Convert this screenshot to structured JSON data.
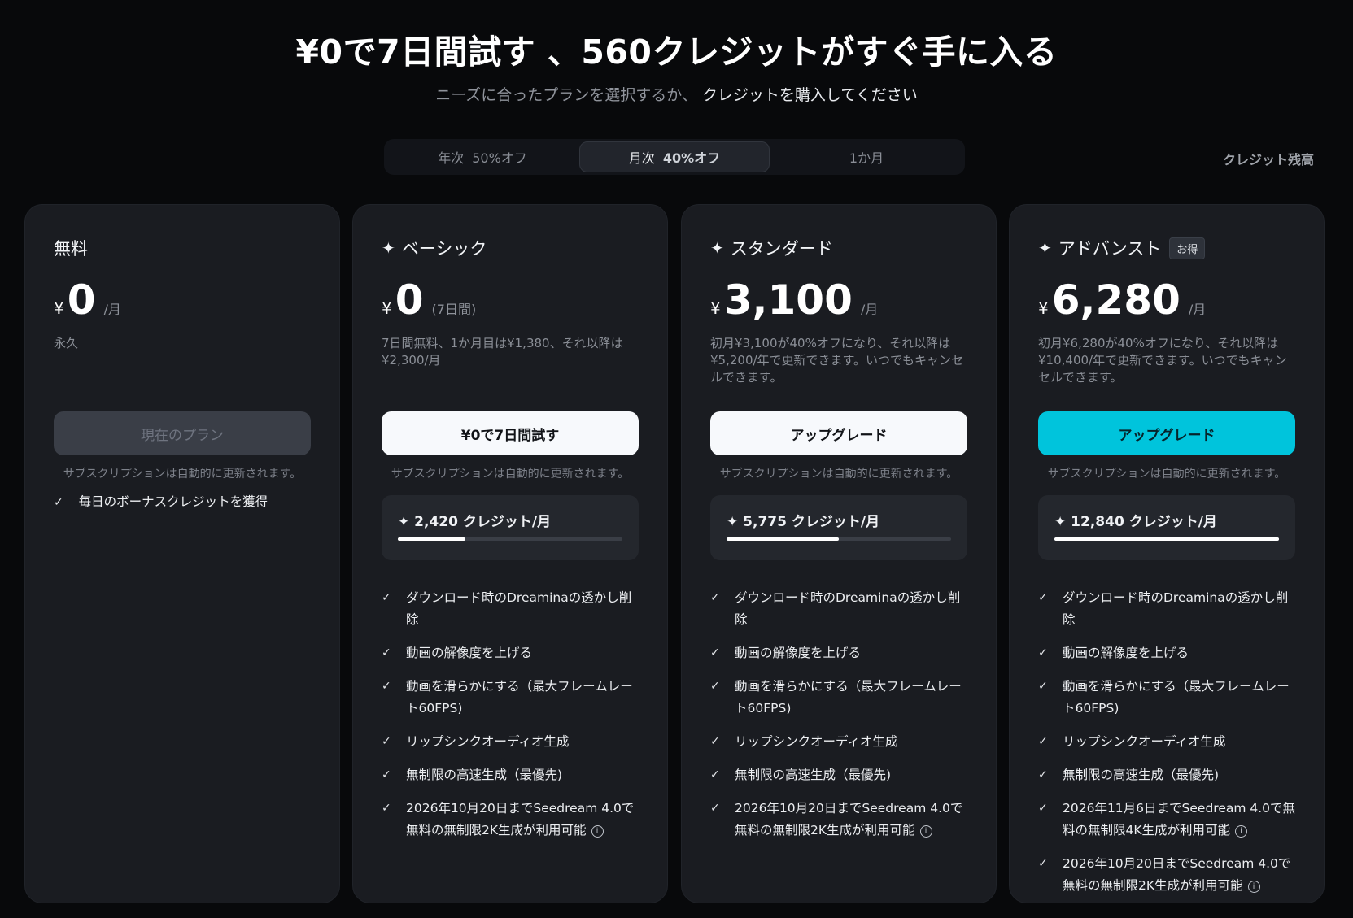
{
  "hero": {
    "title": "¥0で7日間試す 、560クレジットがすぐ手に入る",
    "subtitle_gray": "ニーズに合ったプランを選択するか、",
    "subtitle_link": "クレジットを購入してください"
  },
  "tabs": [
    {
      "label": "年次",
      "discount": "50%オフ"
    },
    {
      "label": "月次",
      "discount": "40%オフ"
    },
    {
      "label": "1か月",
      "discount": ""
    }
  ],
  "credit_balance_label": "クレジット残高",
  "plans": [
    {
      "name": "無料",
      "currency": "¥",
      "amount": "0",
      "period": "/月",
      "description": "永久",
      "cta": "現在のプラン",
      "renew_note": "サブスクリプションは自動的に更新されます。",
      "features": [
        "毎日のボーナスクレジットを獲得"
      ]
    },
    {
      "name": "ベーシック",
      "currency": "¥",
      "amount": "0",
      "period": "(7日間)",
      "description": "7日間無料、1か月目は¥1,380、それ以降は¥2,300/月",
      "cta": "¥0で7日間試す",
      "renew_note": "サブスクリプションは自動的に更新されます。",
      "credits": "2,420 クレジット/月",
      "credit_level": 0.3,
      "features": [
        "ダウンロード時のDreaminaの透かし削除",
        "動画の解像度を上げる",
        "動画を滑らかにする（最大フレームレート60FPS)",
        "リップシンクオーディオ生成",
        "無制限の高速生成（最優先)",
        "2026年10月20日までSeedream 4.0で無料の無制限2K生成が利用可能"
      ]
    },
    {
      "name": "スタンダード",
      "currency": "¥",
      "amount": "3,100",
      "period": "/月",
      "description": "初月¥3,100が40%オフになり、それ以降は¥5,200/年で更新できます。いつでもキャンセルできます。",
      "cta": "アップグレード",
      "renew_note": "サブスクリプションは自動的に更新されます。",
      "credits": "5,775 クレジット/月",
      "credit_level": 0.5,
      "features": [
        "ダウンロード時のDreaminaの透かし削除",
        "動画の解像度を上げる",
        "動画を滑らかにする（最大フレームレート60FPS)",
        "リップシンクオーディオ生成",
        "無制限の高速生成（最優先)",
        "2026年10月20日までSeedream 4.0で無料の無制限2K生成が利用可能"
      ]
    },
    {
      "name": "アドバンスト",
      "badge": "お得",
      "currency": "¥",
      "amount": "6,280",
      "period": "/月",
      "description": "初月¥6,280が40%オフになり、それ以降は¥10,400/年で更新できます。いつでもキャンセルできます。",
      "cta": "アップグレード",
      "renew_note": "サブスクリプションは自動的に更新されます。",
      "credits": "12,840 クレジット/月",
      "credit_level": 1.0,
      "features": [
        "ダウンロード時のDreaminaの透かし削除",
        "動画の解像度を上げる",
        "動画を滑らかにする（最大フレームレート60FPS)",
        "リップシンクオーディオ生成",
        "無制限の高速生成（最優先)",
        "2026年11月6日までSeedream 4.0で無料の無制限4K生成が利用可能",
        "2026年10月20日までSeedream 4.0で無料の無制限2K生成が利用可能"
      ]
    }
  ],
  "colors": {
    "background": "#08090b",
    "card": "#1a1c21",
    "accent_cyan": "#00c4dc"
  }
}
